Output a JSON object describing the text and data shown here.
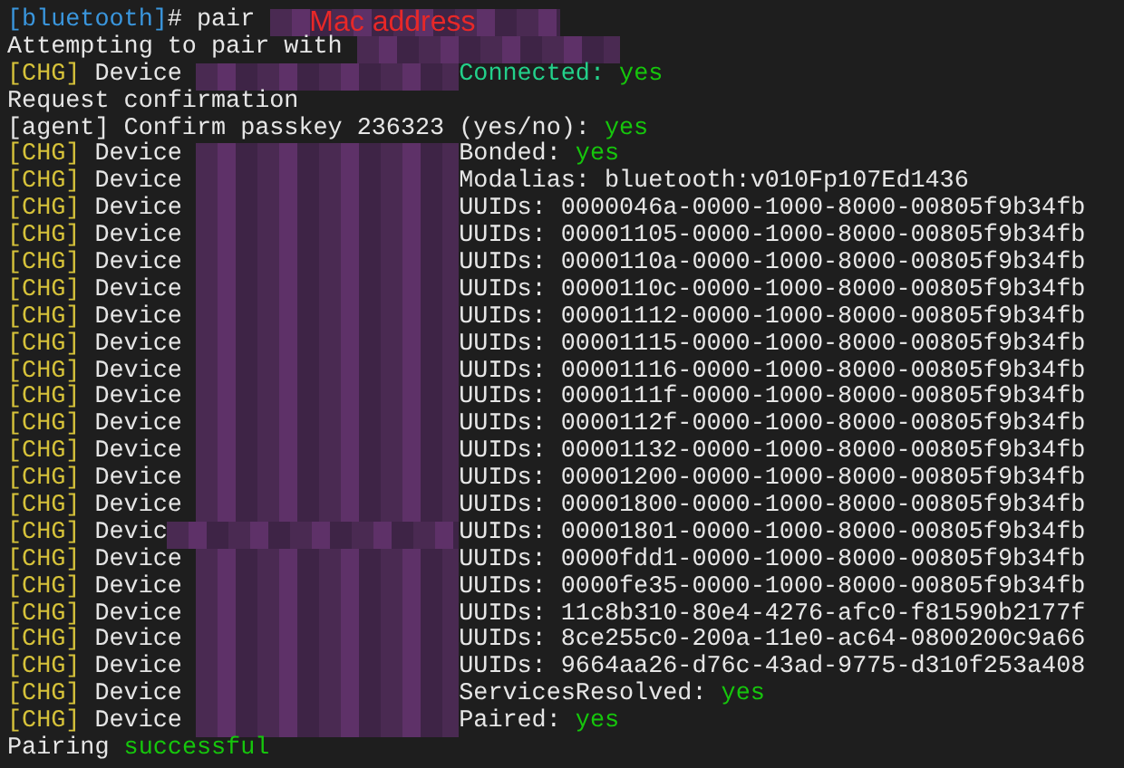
{
  "terminal": {
    "lines": [
      [
        {
          "kind": "prompt",
          "text": "[bluetooth]"
        },
        {
          "kind": "plain",
          "text": "# pair "
        },
        {
          "kind": "redacted",
          "label": "Mac address"
        }
      ],
      [
        {
          "kind": "plain",
          "text": "Attempting to pair with "
        },
        {
          "kind": "redacted"
        }
      ],
      [
        {
          "kind": "tag",
          "text": "[CHG]"
        },
        {
          "kind": "plain",
          "text": " Device "
        },
        {
          "kind": "redacted"
        },
        {
          "kind": "property",
          "text": "Connected: "
        },
        {
          "kind": "yes",
          "text": "yes"
        }
      ],
      [
        {
          "kind": "plain",
          "text": "Request confirmation"
        }
      ],
      [
        {
          "kind": "plain",
          "text": "[agent] Confirm passkey 236323 (yes/no): "
        },
        {
          "kind": "yes",
          "text": "yes"
        }
      ],
      [
        {
          "kind": "tag",
          "text": "[CHG]"
        },
        {
          "kind": "plain",
          "text": " Device "
        },
        {
          "kind": "redacted"
        },
        {
          "kind": "plain",
          "text": "Bonded: "
        },
        {
          "kind": "yes",
          "text": "yes"
        }
      ],
      [
        {
          "kind": "tag",
          "text": "[CHG]"
        },
        {
          "kind": "plain",
          "text": " Device "
        },
        {
          "kind": "redacted"
        },
        {
          "kind": "plain",
          "text": "Modalias: bluetooth:v010Fp107Ed1436"
        }
      ],
      [
        {
          "kind": "tag",
          "text": "[CHG]"
        },
        {
          "kind": "plain",
          "text": " Device "
        },
        {
          "kind": "redacted"
        },
        {
          "kind": "plain",
          "text": "UUIDs: 0000046a-0000-1000-8000-00805f9b34fb"
        }
      ],
      [
        {
          "kind": "tag",
          "text": "[CHG]"
        },
        {
          "kind": "plain",
          "text": " Device "
        },
        {
          "kind": "redacted"
        },
        {
          "kind": "plain",
          "text": "UUIDs: 00001105-0000-1000-8000-00805f9b34fb"
        }
      ],
      [
        {
          "kind": "tag",
          "text": "[CHG]"
        },
        {
          "kind": "plain",
          "text": " Device "
        },
        {
          "kind": "redacted"
        },
        {
          "kind": "plain",
          "text": "UUIDs: 0000110a-0000-1000-8000-00805f9b34fb"
        }
      ],
      [
        {
          "kind": "tag",
          "text": "[CHG]"
        },
        {
          "kind": "plain",
          "text": " Device "
        },
        {
          "kind": "redacted"
        },
        {
          "kind": "plain",
          "text": "UUIDs: 0000110c-0000-1000-8000-00805f9b34fb"
        }
      ],
      [
        {
          "kind": "tag",
          "text": "[CHG]"
        },
        {
          "kind": "plain",
          "text": " Device "
        },
        {
          "kind": "redacted"
        },
        {
          "kind": "plain",
          "text": "UUIDs: 00001112-0000-1000-8000-00805f9b34fb"
        }
      ],
      [
        {
          "kind": "tag",
          "text": "[CHG]"
        },
        {
          "kind": "plain",
          "text": " Device "
        },
        {
          "kind": "redacted"
        },
        {
          "kind": "plain",
          "text": "UUIDs: 00001115-0000-1000-8000-00805f9b34fb"
        }
      ],
      [
        {
          "kind": "tag",
          "text": "[CHG]"
        },
        {
          "kind": "plain",
          "text": " Device "
        },
        {
          "kind": "redacted"
        },
        {
          "kind": "plain",
          "text": "UUIDs: 00001116-0000-1000-8000-00805f9b34fb"
        }
      ],
      [
        {
          "kind": "tag",
          "text": "[CHG]"
        },
        {
          "kind": "plain",
          "text": " Device "
        },
        {
          "kind": "redacted"
        },
        {
          "kind": "plain",
          "text": "UUIDs: 0000111f-0000-1000-8000-00805f9b34fb"
        }
      ],
      [
        {
          "kind": "tag",
          "text": "[CHG]"
        },
        {
          "kind": "plain",
          "text": " Device "
        },
        {
          "kind": "redacted"
        },
        {
          "kind": "plain",
          "text": "UUIDs: 0000112f-0000-1000-8000-00805f9b34fb"
        }
      ],
      [
        {
          "kind": "tag",
          "text": "[CHG]"
        },
        {
          "kind": "plain",
          "text": " Device "
        },
        {
          "kind": "redacted"
        },
        {
          "kind": "plain",
          "text": "UUIDs: 00001132-0000-1000-8000-00805f9b34fb"
        }
      ],
      [
        {
          "kind": "tag",
          "text": "[CHG]"
        },
        {
          "kind": "plain",
          "text": " Device "
        },
        {
          "kind": "redacted"
        },
        {
          "kind": "plain",
          "text": "UUIDs: 00001200-0000-1000-8000-00805f9b34fb"
        }
      ],
      [
        {
          "kind": "tag",
          "text": "[CHG]"
        },
        {
          "kind": "plain",
          "text": " Device "
        },
        {
          "kind": "redacted"
        },
        {
          "kind": "plain",
          "text": "UUIDs: 00001800-0000-1000-8000-00805f9b34fb"
        }
      ],
      [
        {
          "kind": "tag",
          "text": "[CHG]"
        },
        {
          "kind": "plain",
          "text": " Devic"
        },
        {
          "kind": "redacted"
        },
        {
          "kind": "plain",
          "text": "UUIDs: 00001801-0000-1000-8000-00805f9b34fb"
        }
      ],
      [
        {
          "kind": "tag",
          "text": "[CHG]"
        },
        {
          "kind": "plain",
          "text": " Device "
        },
        {
          "kind": "redacted"
        },
        {
          "kind": "plain",
          "text": "UUIDs: 0000fdd1-0000-1000-8000-00805f9b34fb"
        }
      ],
      [
        {
          "kind": "tag",
          "text": "[CHG]"
        },
        {
          "kind": "plain",
          "text": " Device "
        },
        {
          "kind": "redacted"
        },
        {
          "kind": "plain",
          "text": "UUIDs: 0000fe35-0000-1000-8000-00805f9b34fb"
        }
      ],
      [
        {
          "kind": "tag",
          "text": "[CHG]"
        },
        {
          "kind": "plain",
          "text": " Device "
        },
        {
          "kind": "redacted"
        },
        {
          "kind": "plain",
          "text": "UUIDs: 11c8b310-80e4-4276-afc0-f81590b2177f"
        }
      ],
      [
        {
          "kind": "tag",
          "text": "[CHG]"
        },
        {
          "kind": "plain",
          "text": " Device "
        },
        {
          "kind": "redacted"
        },
        {
          "kind": "plain",
          "text": "UUIDs: 8ce255c0-200a-11e0-ac64-0800200c9a66"
        }
      ],
      [
        {
          "kind": "tag",
          "text": "[CHG]"
        },
        {
          "kind": "plain",
          "text": " Device "
        },
        {
          "kind": "redacted"
        },
        {
          "kind": "plain",
          "text": "UUIDs: 9664aa26-d76c-43ad-9775-d310f253a408"
        }
      ],
      [
        {
          "kind": "tag",
          "text": "[CHG]"
        },
        {
          "kind": "plain",
          "text": " Device "
        },
        {
          "kind": "redacted"
        },
        {
          "kind": "plain",
          "text": "ServicesResolved: "
        },
        {
          "kind": "yes",
          "text": "yes"
        }
      ],
      [
        {
          "kind": "tag",
          "text": "[CHG]"
        },
        {
          "kind": "plain",
          "text": " Device "
        },
        {
          "kind": "redacted"
        },
        {
          "kind": "plain",
          "text": "Paired: "
        },
        {
          "kind": "yes",
          "text": "yes"
        }
      ],
      [
        {
          "kind": "plain",
          "text": "Pairing "
        },
        {
          "kind": "yes",
          "text": "successful"
        }
      ]
    ]
  }
}
